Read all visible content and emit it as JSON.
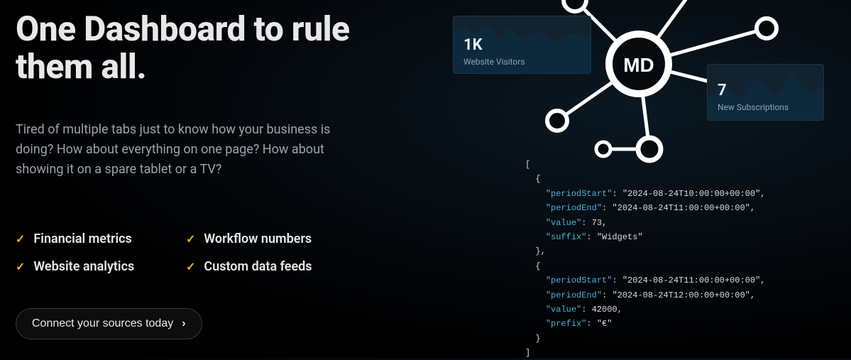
{
  "headline": "One Dashboard to rule them all.",
  "subtext": "Tired of multiple tabs just to know how your business is doing? How about everything on one page? How about showing it on a spare tablet or a TV?",
  "features": [
    "Financial metrics",
    "Workflow numbers",
    "Website analytics",
    "Custom data feeds"
  ],
  "cta_label": "Connect your sources today",
  "logo_text": "MD",
  "stats": {
    "visitors": {
      "value": "1K",
      "label": "Website Visitors"
    },
    "subs": {
      "value": "7",
      "label": "New Subscriptions"
    }
  },
  "code_sample": [
    {
      "periodStart": "2024-08-24T10:00:00+00:00",
      "periodEnd": "2024-08-24T11:00:00+00:00",
      "value": 73,
      "suffix": "Widgets"
    },
    {
      "periodStart": "2024-08-24T11:00:00+00:00",
      "periodEnd": "2024-08-24T12:00:00+00:00",
      "value": 42000,
      "prefix": "€"
    }
  ],
  "colors": {
    "accent": "#eab308",
    "card_bg": "#12232f",
    "code_key": "#4db1d6"
  }
}
